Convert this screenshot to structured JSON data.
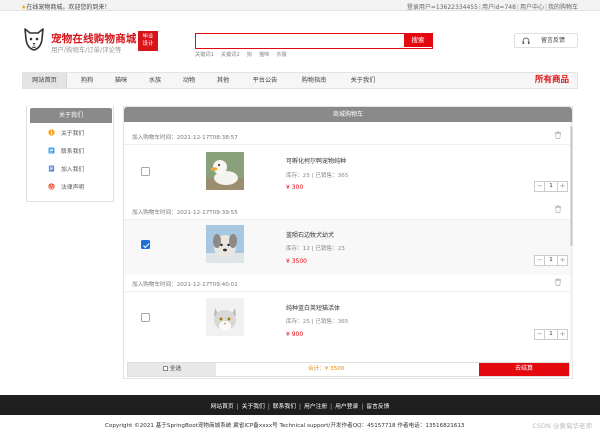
{
  "topbar": {
    "welcome": "在线宠物商城，欢迎您的到来！",
    "links": [
      "登录用户=13622334455",
      "用户id=748",
      "用户中心",
      "我的购物车"
    ]
  },
  "header": {
    "title": "宠物在线购物商城",
    "subtitle": "用户/购物车/订单/评论等",
    "badge_line1": "毕业",
    "badge_line2": "设计",
    "search": {
      "value": "",
      "button": "搜索"
    },
    "hotwords": [
      "关键词1",
      "关键词2",
      "狗",
      "猫咪",
      "衣服"
    ],
    "message_button": "留言反馈"
  },
  "nav": {
    "items": [
      "网站首页",
      "狗狗",
      "猫咪",
      "水族",
      "动物",
      "其他",
      "平台公告",
      "购物指南",
      "关于我们"
    ],
    "all_products": "所有商品"
  },
  "sidebar": {
    "title": "关于我们",
    "items": [
      "关于我们",
      "联系我们",
      "加入我们",
      "法律声明"
    ]
  },
  "cart": {
    "title": "商城购物车",
    "items": [
      {
        "time": "加入购物车时间：2021-12-17T08:38:57",
        "name": "可孵化柯尔鸭宠物纯种",
        "info": "库存：25 | 已销售：365",
        "price": "¥ 300",
        "qty": "1",
        "checked": false
      },
      {
        "time": "加入购物车时间：2021-12-17T09:39:55",
        "name": "蓝陨石边牧犬幼犬",
        "info": "库存：12 | 已销售：23",
        "price": "¥ 3500",
        "qty": "1",
        "checked": true
      },
      {
        "time": "加入购物车时间：2021-12-17T09:40:01",
        "name": "纯种蓝白英短猫活体",
        "info": "库存：25 | 已销售：365",
        "price": "¥ 900",
        "qty": "1",
        "checked": false
      }
    ],
    "select_all": "全选",
    "total": "合计：¥ 3500",
    "settle": "去结算"
  },
  "footer": {
    "links": [
      "网站首页",
      "关于我们",
      "联系我们",
      "用户注册",
      "用户登录",
      "留言反馈"
    ],
    "copyright": "Copyright ©2021 基于SpringBoot宠物商城系统    冀省ICP备xxxx号    Technical support/开发作者QQ：45157718    作者电话：13516821613",
    "watermark": "CSDN @黄菊华老师"
  },
  "colors": {
    "accent": "#e4090f",
    "brand": "#d8141b",
    "check": "#1e6fd6",
    "total": "#f08a00"
  }
}
